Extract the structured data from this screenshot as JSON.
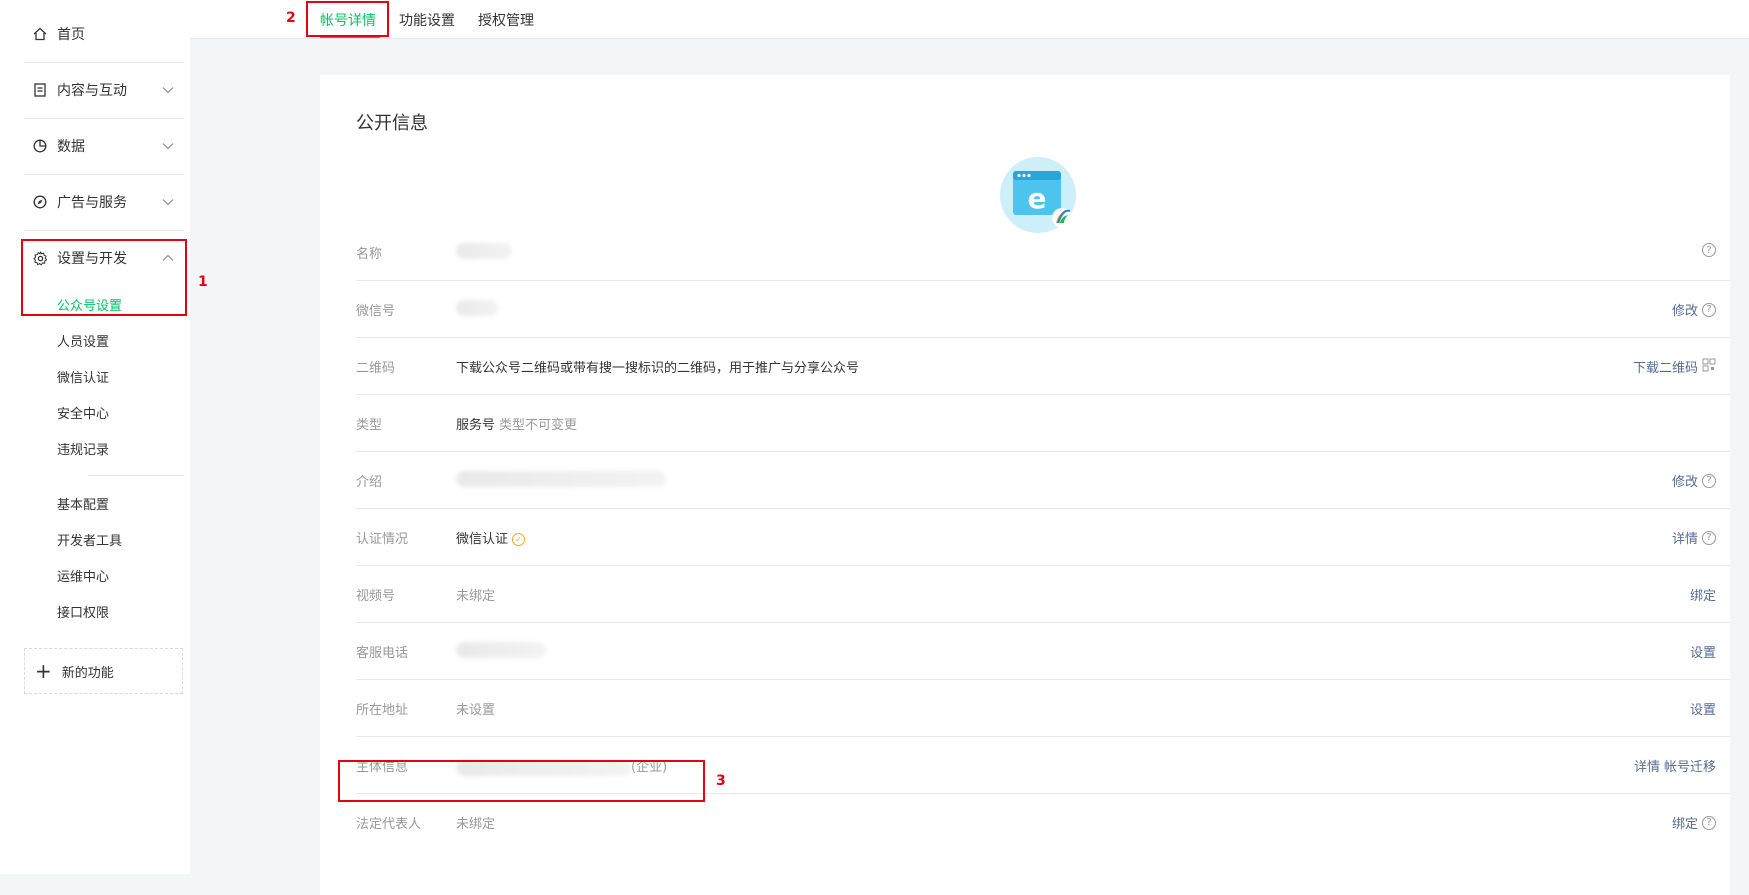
{
  "sidebar": {
    "items": [
      {
        "label": "首页",
        "icon": "home-icon"
      },
      {
        "label": "内容与互动",
        "icon": "document-icon"
      },
      {
        "label": "数据",
        "icon": "pie-chart-icon"
      },
      {
        "label": "广告与服务",
        "icon": "compass-icon"
      },
      {
        "label": "设置与开发",
        "icon": "gear-icon"
      }
    ],
    "sub_items": [
      "公众号设置",
      "人员设置",
      "微信认证",
      "安全中心",
      "违规记录"
    ],
    "dev_items": [
      "基本配置",
      "开发者工具",
      "运维中心",
      "接口权限"
    ],
    "new_function": "新的功能"
  },
  "tabs": [
    "帐号详情",
    "功能设置",
    "授权管理"
  ],
  "panel": {
    "title": "公开信息",
    "rows": [
      {
        "key": "名称",
        "value": "",
        "action": "",
        "help": true
      },
      {
        "key": "微信号",
        "value": "",
        "action": "修改",
        "help": true
      },
      {
        "key": "二维码",
        "value": "下载公众号二维码或带有搜一搜标识的二维码，用于推广与分享公众号",
        "action": "下载二维码",
        "help": false
      },
      {
        "key": "类型",
        "value": "服务号",
        "extra": "类型不可变更",
        "action": "",
        "help": false
      },
      {
        "key": "介绍",
        "value": "",
        "action": "修改",
        "help": true
      },
      {
        "key": "认证情况",
        "value": "微信认证",
        "action": "详情",
        "help": true
      },
      {
        "key": "视频号",
        "value": "未绑定",
        "action": "绑定",
        "help": false
      },
      {
        "key": "客服电话",
        "value": "",
        "action": "设置",
        "help": false
      },
      {
        "key": "所在地址",
        "value": "未设置",
        "action": "设置",
        "help": false
      },
      {
        "key": "主体信息",
        "value": "(企业)",
        "action": "详情",
        "action2": "帐号迁移",
        "help": false
      },
      {
        "key": "法定代表人",
        "value": "未绑定",
        "action": "绑定",
        "help": true
      }
    ]
  },
  "annotations": [
    "1",
    "2",
    "3"
  ],
  "colors": {
    "accent": "#07c160",
    "link": "#576b95",
    "annotation": "#e60012"
  }
}
